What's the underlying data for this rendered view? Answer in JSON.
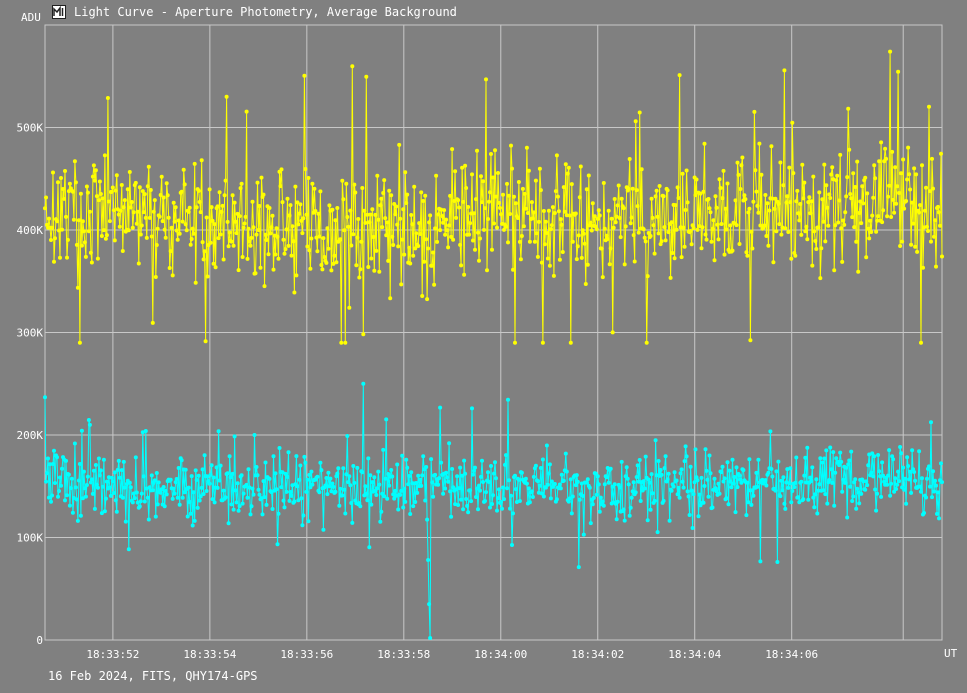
{
  "window": {
    "title": "Light Curve - Aperture Photometry, Average Background",
    "icon": "light-curve-app-icon"
  },
  "footer": {
    "caption": "16 Feb 2024, FITS, QHY174-GPS"
  },
  "colors": {
    "background": "#808080",
    "grid": "#c8c8c8",
    "text": "#ffffff",
    "series_target": "#ffff00",
    "series_background": "#00ffff"
  },
  "chart_data": {
    "type": "line",
    "title": "Light Curve - Aperture Photometry, Average Background",
    "xlabel": "UT",
    "ylabel": "ADU",
    "ylim": [
      0,
      600000
    ],
    "xlim": [
      "18:33:50.3",
      "18:34:08.8"
    ],
    "x_tick_labels": [
      "18:33:52",
      "18:33:54",
      "18:33:56",
      "18:33:58",
      "18:34:00",
      "18:34:02",
      "18:34:04",
      "18:34:06"
    ],
    "x_ticks_seconds_after_18_33_50": [
      1.7,
      3.7,
      5.7,
      7.7,
      9.7,
      11.7,
      13.7,
      15.7
    ],
    "y_tick_labels": [
      "0",
      "100K",
      "200K",
      "300K",
      "400K",
      "500K"
    ],
    "y_ticks": [
      0,
      100000,
      200000,
      300000,
      400000,
      500000
    ],
    "grid": true,
    "legend": "none",
    "series": [
      {
        "color": "#ffff00",
        "n_points": 900,
        "mean": 410000,
        "typical_range": [
          320000,
          500000
        ],
        "extremes": {
          "min": 290000,
          "max": 580000
        },
        "x": [
          50.3,
          51.7,
          53.7,
          55.7,
          57.7,
          58.0,
          59.7,
          61.7,
          63.7,
          65.7,
          68.0,
          68.8
        ],
        "values": [
          420000,
          415000,
          410000,
          400000,
          405000,
          400000,
          420000,
          410000,
          415000,
          420000,
          430000,
          410000
        ]
      },
      {
        "color": "#00ffff",
        "n_points": 900,
        "mean": 150000,
        "typical_range": [
          100000,
          200000
        ],
        "extremes": {
          "min": 2000,
          "max": 250000
        },
        "dip": {
          "x": 58.2,
          "values": [
            78000,
            35000,
            2000
          ]
        },
        "x": [
          50.3,
          51.7,
          53.7,
          55.7,
          57.7,
          58.2,
          59.7,
          61.7,
          63.7,
          65.7,
          68.0,
          68.8
        ],
        "values": [
          155000,
          150000,
          148000,
          150000,
          150000,
          2000,
          150000,
          148000,
          150000,
          155000,
          160000,
          140000
        ]
      }
    ]
  }
}
